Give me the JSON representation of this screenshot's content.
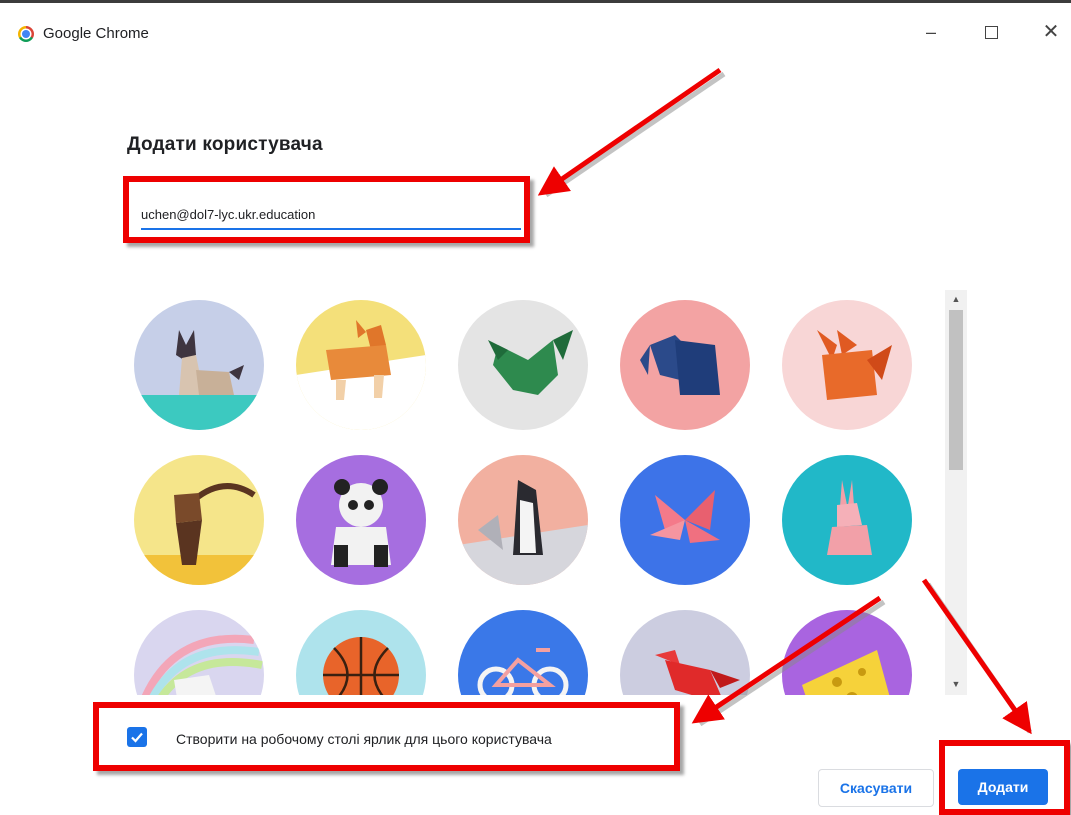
{
  "window": {
    "app_title": "Google Chrome",
    "minimize_glyph": "–",
    "close_glyph": "✕"
  },
  "dialog": {
    "title": "Додати користувача",
    "email_value": "uchen@dol7-lyc.ukr.education",
    "avatars": [
      {
        "name": "origami-cat",
        "bg": "#c6cfe8"
      },
      {
        "name": "origami-corgi",
        "bg": "#f4e07a"
      },
      {
        "name": "origami-dragon",
        "bg": "#e4e4e4"
      },
      {
        "name": "origami-elephant",
        "bg": "#f3a3a3"
      },
      {
        "name": "origami-fox",
        "bg": "#f8d6d6"
      },
      {
        "name": "origami-monkey",
        "bg": "#f5e58a"
      },
      {
        "name": "origami-panda",
        "bg": "#a66ee0"
      },
      {
        "name": "origami-penguin",
        "bg": "#f2b0a0"
      },
      {
        "name": "origami-butterfly",
        "bg": "#3d73e8"
      },
      {
        "name": "origami-rabbit",
        "bg": "#21b8c8"
      },
      {
        "name": "origami-unicorn",
        "bg": "#d9d6ef"
      },
      {
        "name": "origami-basketball",
        "bg": "#aee3ec"
      },
      {
        "name": "origami-bicycle",
        "bg": "#3a78e8"
      },
      {
        "name": "origami-bird",
        "bg": "#cccde0"
      },
      {
        "name": "origami-cheese",
        "bg": "#a964e0"
      }
    ],
    "shortcut_checkbox": {
      "checked": true,
      "label": "Створити на робочому столі ярлик для цього користувача"
    },
    "cancel_label": "Скасувати",
    "add_label": "Додати"
  },
  "colors": {
    "accent": "#1a73e8",
    "annotation_red": "#ee0000"
  }
}
